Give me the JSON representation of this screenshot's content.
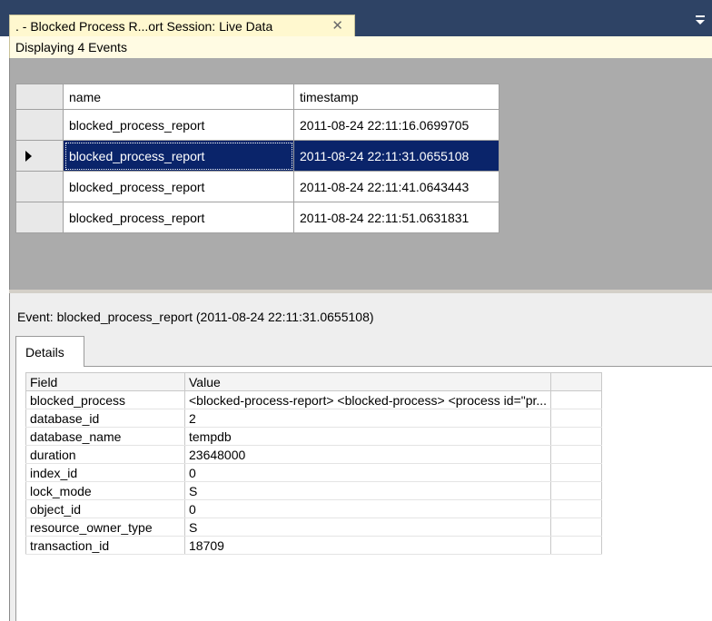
{
  "tab": {
    "title": ". - Blocked Process R...ort Session: Live Data",
    "close_icon": "close-icon",
    "overflow_icon": "tab-overflow-icon"
  },
  "status": {
    "text": "Displaying 4 Events"
  },
  "events_grid": {
    "columns": [
      "name",
      "timestamp"
    ],
    "rows": [
      {
        "name": "blocked_process_report",
        "timestamp": "2011-08-24 22:11:16.0699705",
        "selected": false
      },
      {
        "name": "blocked_process_report",
        "timestamp": "2011-08-24 22:11:31.0655108",
        "selected": true
      },
      {
        "name": "blocked_process_report",
        "timestamp": "2011-08-24 22:11:41.0643443",
        "selected": false
      },
      {
        "name": "blocked_process_report",
        "timestamp": "2011-08-24 22:11:51.0631831",
        "selected": false
      }
    ]
  },
  "event_detail": {
    "header": "Event: blocked_process_report (2011-08-24 22:11:31.0655108)",
    "tab_label": "Details",
    "columns": [
      "Field",
      "Value"
    ],
    "rows": [
      {
        "field": "blocked_process",
        "value": "<blocked-process-report>  <blocked-process>    <process id=\"pr..."
      },
      {
        "field": "database_id",
        "value": "2"
      },
      {
        "field": "database_name",
        "value": "tempdb"
      },
      {
        "field": "duration",
        "value": "23648000"
      },
      {
        "field": "index_id",
        "value": "0"
      },
      {
        "field": "lock_mode",
        "value": "S"
      },
      {
        "field": "object_id",
        "value": "0"
      },
      {
        "field": "resource_owner_type",
        "value": "S"
      },
      {
        "field": "transaction_id",
        "value": "18709"
      }
    ]
  },
  "colors": {
    "tabstrip_bg": "#2e4365",
    "active_tab_bg": "#fff8cf",
    "selection_bg": "#0a246a",
    "grid_bg": "#ababab"
  }
}
